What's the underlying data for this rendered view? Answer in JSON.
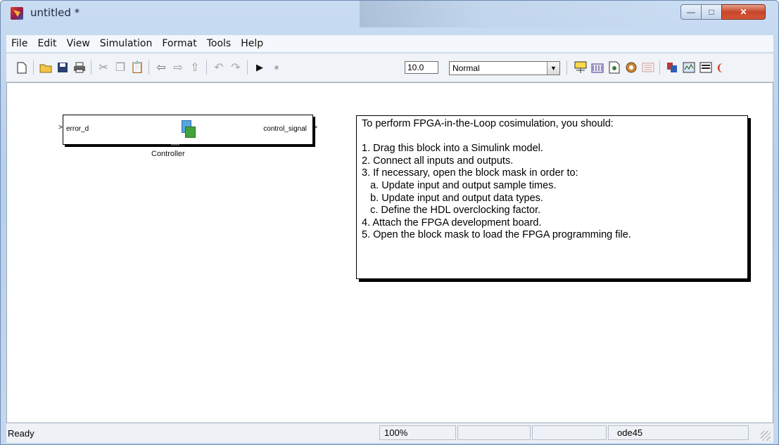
{
  "window": {
    "title": "untitled *"
  },
  "window_controls": {
    "minimize": "—",
    "maximize": "□",
    "close": "✕"
  },
  "menubar": {
    "items": [
      "File",
      "Edit",
      "View",
      "Simulation",
      "Format",
      "Tools",
      "Help"
    ]
  },
  "toolbar": {
    "stop_time": "10.0",
    "mode": "Normal",
    "icons": [
      "new",
      "open",
      "save",
      "print",
      "cut",
      "copy",
      "paste",
      "back",
      "forward",
      "up",
      "undo",
      "redo",
      "start-simulation",
      "stop-simulation",
      "build",
      "library",
      "model-explorer",
      "debugger",
      "diagnostics",
      "fpga",
      "scope",
      "config",
      "more"
    ]
  },
  "canvas": {
    "block": {
      "input_port": "error_d",
      "output_port": "control_signal",
      "label": "Controller"
    },
    "note": {
      "lines": [
        "To perform FPGA-in-the-Loop cosimulation, you should:",
        "",
        "1. Drag this block into a Simulink model.",
        "2. Connect all inputs and outputs.",
        "3. If necessary, open the block mask in order to:",
        "   a. Update input and output sample times.",
        "   b. Update input and output data types.",
        "   c. Define the HDL overclocking factor.",
        "4. Attach the FPGA development board.",
        "5. Open the block mask to load the FPGA programming file."
      ]
    }
  },
  "statusbar": {
    "status": "Ready",
    "zoom": "100%",
    "blank1": "",
    "blank2": "",
    "solver": "ode45"
  }
}
